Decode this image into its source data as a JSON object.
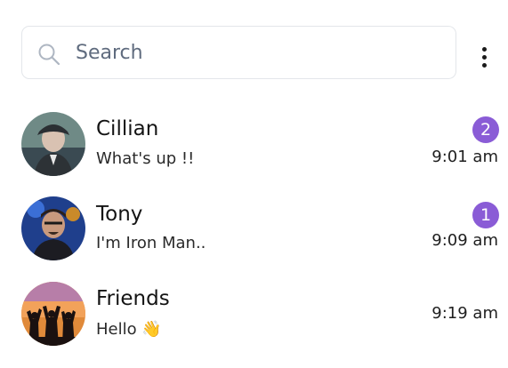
{
  "search": {
    "placeholder": "Search",
    "value": "",
    "icon": "search-icon"
  },
  "menu": {
    "icon": "more-vertical-icon"
  },
  "chats": [
    {
      "name": "Cillian",
      "preview": "What's up !!",
      "time": "9:01 am",
      "unread": "2",
      "avatar_icon": "avatar-photo"
    },
    {
      "name": "Tony",
      "preview": "I'm Iron Man..",
      "time": "9:09 am",
      "unread": "1",
      "avatar_icon": "avatar-photo"
    },
    {
      "name": "Friends",
      "preview": "Hello 👋",
      "time": "9:19 am",
      "avatar_icon": "avatar-group-photo"
    }
  ],
  "colors": {
    "badge": "#8a5cd6",
    "border": "#e3e6ea",
    "placeholder": "#5f6b7e"
  }
}
